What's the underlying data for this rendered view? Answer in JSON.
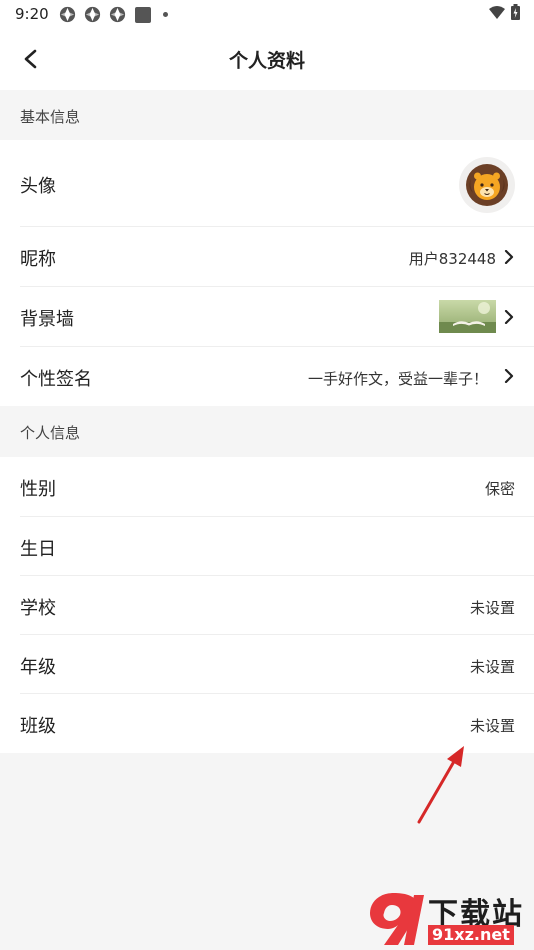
{
  "status_bar": {
    "time": "9:20"
  },
  "header": {
    "title": "个人资料"
  },
  "sections": {
    "basic": "基本信息",
    "personal": "个人信息"
  },
  "rows": {
    "avatar": {
      "label": "头像"
    },
    "nickname": {
      "label": "昵称",
      "value": "用户832448"
    },
    "background": {
      "label": "背景墙"
    },
    "signature": {
      "label": "个性签名",
      "value": "一手好作文，受益一辈子！"
    },
    "gender": {
      "label": "性别",
      "value": "保密"
    },
    "birthday": {
      "label": "生日",
      "value": ""
    },
    "school": {
      "label": "学校",
      "value": "未设置"
    },
    "grade": {
      "label": "年级",
      "value": "未设置"
    },
    "class": {
      "label": "班级",
      "value": "未设置"
    }
  },
  "watermark": {
    "title": "下载站",
    "url": "91xz.net"
  },
  "colors": {
    "background": "#f5f5f5",
    "surface": "#ffffff",
    "annotation_arrow": "#d62828",
    "watermark_red": "#e8383d"
  },
  "icons": [
    "back-arrow-icon",
    "chevron-right-icon",
    "lion-avatar-icon",
    "wifi-icon",
    "battery-icon"
  ]
}
